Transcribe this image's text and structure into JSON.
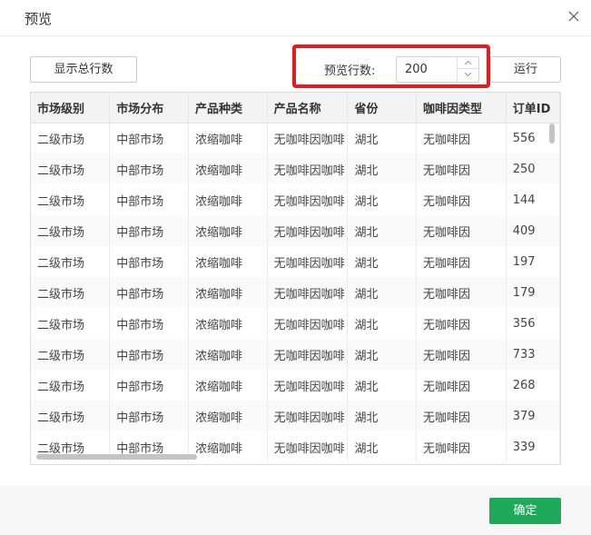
{
  "dialog": {
    "title": "预览"
  },
  "toolbar": {
    "show_total_label": "显示总行数",
    "preview_rows_label": "预览行数:",
    "preview_rows_value": "200",
    "run_label": "运行"
  },
  "table": {
    "columns": [
      "市场级别",
      "市场分布",
      "产品种类",
      "产品名称",
      "省份",
      "咖啡因类型",
      "订单ID"
    ],
    "rows": [
      [
        "二级市场",
        "中部市场",
        "浓缩咖啡",
        "无咖啡因咖啡",
        "湖北",
        "无咖啡因",
        "556"
      ],
      [
        "二级市场",
        "中部市场",
        "浓缩咖啡",
        "无咖啡因咖啡",
        "湖北",
        "无咖啡因",
        "250"
      ],
      [
        "二级市场",
        "中部市场",
        "浓缩咖啡",
        "无咖啡因咖啡",
        "湖北",
        "无咖啡因",
        "144"
      ],
      [
        "二级市场",
        "中部市场",
        "浓缩咖啡",
        "无咖啡因咖啡",
        "湖北",
        "无咖啡因",
        "409"
      ],
      [
        "二级市场",
        "中部市场",
        "浓缩咖啡",
        "无咖啡因咖啡",
        "湖北",
        "无咖啡因",
        "197"
      ],
      [
        "二级市场",
        "中部市场",
        "浓缩咖啡",
        "无咖啡因咖啡",
        "湖北",
        "无咖啡因",
        "179"
      ],
      [
        "二级市场",
        "中部市场",
        "浓缩咖啡",
        "无咖啡因咖啡",
        "湖北",
        "无咖啡因",
        "356"
      ],
      [
        "二级市场",
        "中部市场",
        "浓缩咖啡",
        "无咖啡因咖啡",
        "湖北",
        "无咖啡因",
        "733"
      ],
      [
        "二级市场",
        "中部市场",
        "浓缩咖啡",
        "无咖啡因咖啡",
        "湖北",
        "无咖啡因",
        "268"
      ],
      [
        "二级市场",
        "中部市场",
        "浓缩咖啡",
        "无咖啡因咖啡",
        "湖北",
        "无咖啡因",
        "379"
      ],
      [
        "二级市场",
        "中部市场",
        "浓缩咖啡",
        "无咖啡因咖啡",
        "湖北",
        "无咖啡因",
        "339"
      ]
    ]
  },
  "footer": {
    "confirm_label": "确定"
  },
  "colors": {
    "highlight": "#e11d1d",
    "primary": "#1fa95a",
    "header_bg": "#f3f3f3"
  },
  "icons": {
    "close": "close-icon",
    "step_up": "chevron-up-icon",
    "step_down": "chevron-down-icon"
  }
}
